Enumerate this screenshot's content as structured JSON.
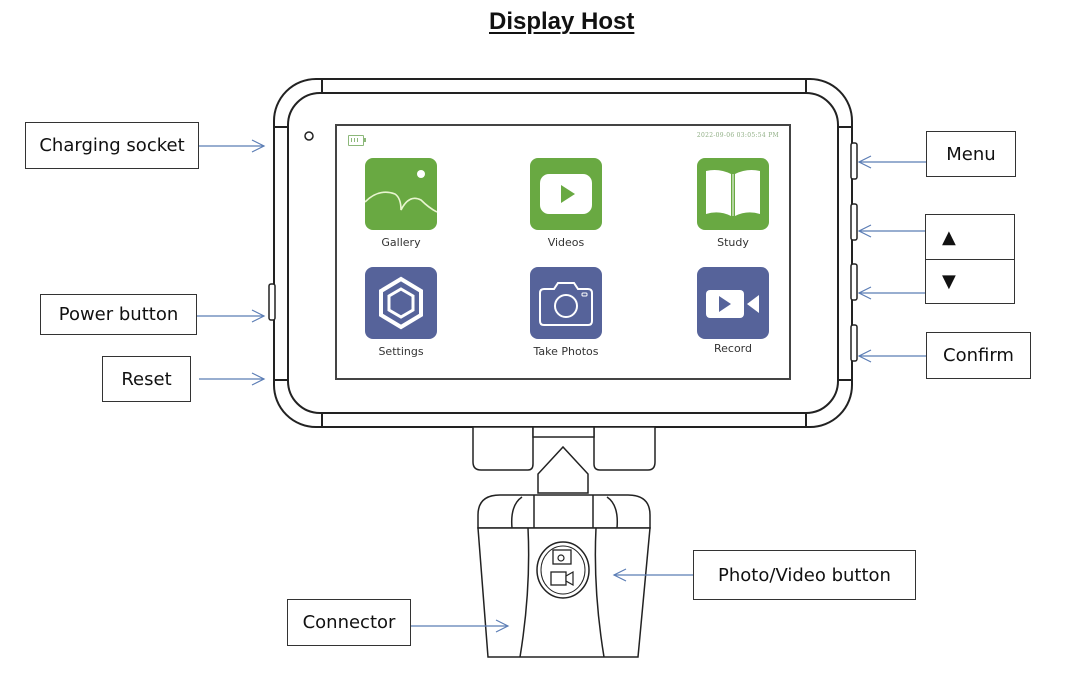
{
  "title": "Display Host",
  "colors": {
    "app_green": "#69a942",
    "app_blue": "#56639a",
    "arrow": "#5b7db5"
  },
  "screen": {
    "battery_icon": "battery-icon",
    "timestamp": "2022-09-06 03:05:54 PM",
    "apps": [
      {
        "label": "Gallery",
        "icon": "image-icon"
      },
      {
        "label": "Videos",
        "icon": "play-icon"
      },
      {
        "label": "Study",
        "icon": "book-icon"
      },
      {
        "label": "Settings",
        "icon": "hexagon-gear-icon"
      },
      {
        "label": "Take Photos",
        "icon": "camera-icon"
      },
      {
        "label": "Record",
        "icon": "video-camera-icon"
      }
    ]
  },
  "callouts": {
    "left": {
      "charging_socket": "Charging socket",
      "power_button": "Power button",
      "reset": "Reset",
      "connector": "Connector"
    },
    "right": {
      "menu": "Menu",
      "up": "▲",
      "down": "▼",
      "confirm": "Confirm",
      "photo_video_button": "Photo/Video button"
    }
  }
}
